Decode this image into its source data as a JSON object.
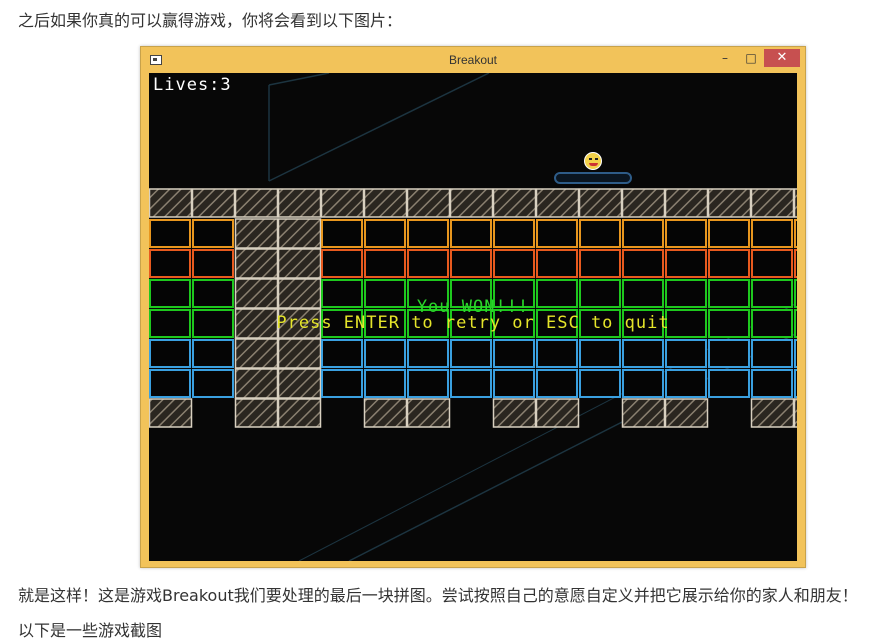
{
  "article": {
    "intro": "之后如果你真的可以赢得游戏，你将会看到以下图片：",
    "outro": "就是这样！这是游戏Breakout我们要处理的最后一块拼图。尝试按照自己的意愿自定义并把它展示给你的家人和朋友！",
    "next": "以下是一些游戏截图"
  },
  "window": {
    "title": "Breakout",
    "min_glyph": "–",
    "max_glyph": "□",
    "close_glyph": "✕"
  },
  "game": {
    "lives": "Lives:3",
    "win_text": "You WON!!!",
    "prompt": "Press ENTER to retry or ESC to quit"
  },
  "colors": {
    "orange": "#e8961e",
    "red_orange": "#e85a1e",
    "green": "#1ec81e",
    "blue": "#3aa0e0",
    "solid_block": "#b8b0a0"
  }
}
